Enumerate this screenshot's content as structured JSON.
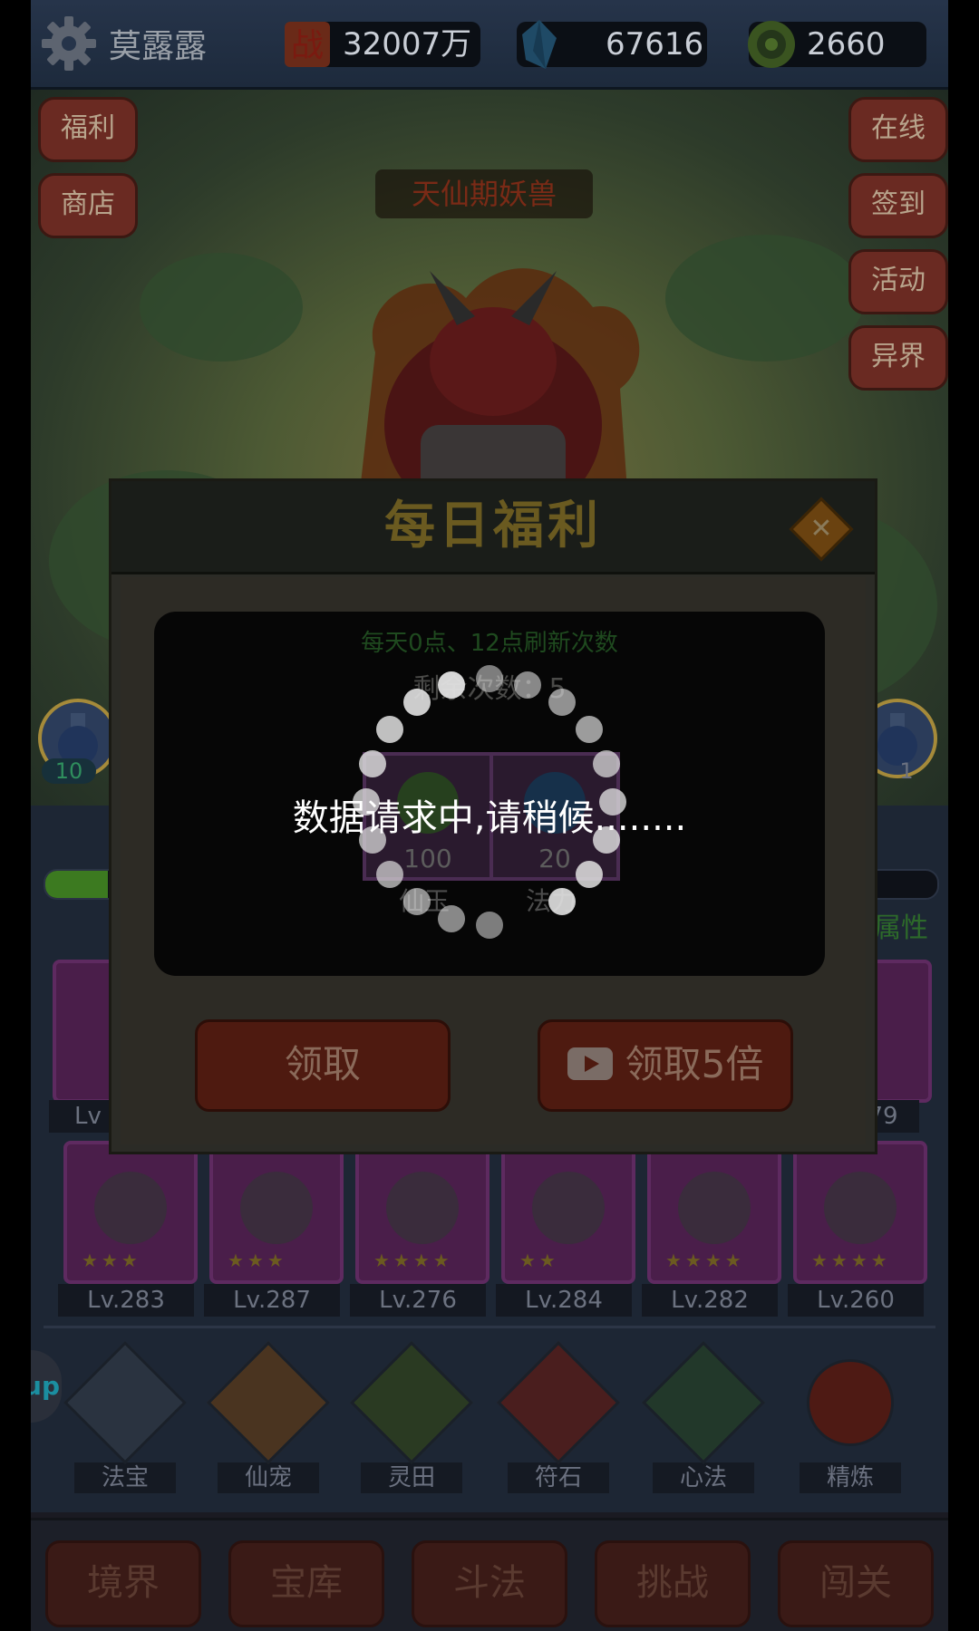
{
  "player": {
    "name": "莫露露"
  },
  "resources": [
    {
      "icon": "battle-power-icon",
      "value": "32007万"
    },
    {
      "icon": "crystal-icon",
      "value": "67616"
    },
    {
      "icon": "jade-coin-icon",
      "value": "2660"
    }
  ],
  "left_menu": [
    {
      "label": "福利"
    },
    {
      "label": "商店"
    }
  ],
  "right_menu": [
    {
      "label": "在线"
    },
    {
      "label": "签到"
    },
    {
      "label": "活动"
    },
    {
      "label": "异界"
    }
  ],
  "boss": {
    "name": "天仙期妖兽"
  },
  "potions": {
    "left_count": "10",
    "right_count": "1"
  },
  "attribute_tab": "属性",
  "cards_row1_partial": [
    "Lv",
    "79"
  ],
  "cards_row2": [
    {
      "icon": "wing-icon",
      "level": "Lv.283"
    },
    {
      "icon": "lotus-icon",
      "level": "Lv.287"
    },
    {
      "icon": "gauntlet-icon",
      "level": "Lv.276"
    },
    {
      "icon": "robe-icon",
      "level": "Lv.284"
    },
    {
      "icon": "spirit-icon",
      "level": "Lv.282"
    },
    {
      "icon": "cloak-icon",
      "level": "Lv.260"
    }
  ],
  "functions": [
    {
      "label": "法宝",
      "icon": "treasure-icon"
    },
    {
      "label": "仙宠",
      "icon": "pet-cat-icon"
    },
    {
      "label": "灵田",
      "icon": "field-plant-icon"
    },
    {
      "label": "符石",
      "icon": "rune-stone-icon"
    },
    {
      "label": "心法",
      "icon": "scripture-icon"
    },
    {
      "label": "精炼",
      "icon": "refine-scroll-icon"
    }
  ],
  "bottom_nav": [
    "境界",
    "宝库",
    "斗法",
    "挑战",
    "闯关"
  ],
  "side_tab": "up",
  "dialog": {
    "title": "每日福利",
    "refresh_note": "每天0点、12点刷新次数",
    "remaining_label": "剩余次数：",
    "remaining_value": "5",
    "rewards": [
      {
        "value": "100",
        "label": "仙玉",
        "icon": "jade-melon-icon"
      },
      {
        "value": "20",
        "label": "法力",
        "icon": "mana-orb-icon"
      }
    ],
    "claim_label": "领取",
    "claim5x_label": "领取5倍"
  },
  "loading": {
    "message": "数据请求中,请稍候........"
  },
  "colors": {
    "accent_gold": "#6a5a20",
    "loading_bg": "#060606",
    "spinner": "#e0e0e0"
  }
}
